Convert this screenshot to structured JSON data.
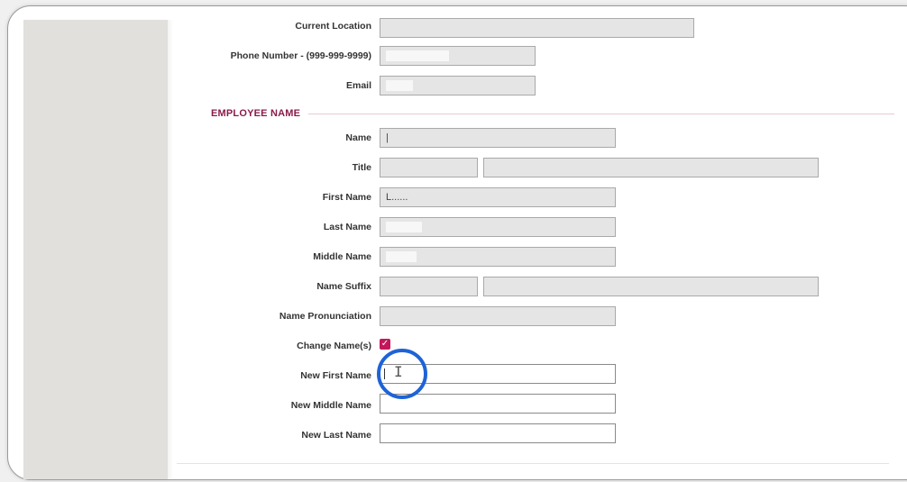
{
  "form": {
    "contact": {
      "current_location_label": "Current Location",
      "phone_label": "Phone Number - (999-999-9999)",
      "email_label": "Email"
    },
    "section_title": "EMPLOYEE NAME",
    "employee_name": {
      "name_label": "Name",
      "name_value": "|",
      "title_label": "Title",
      "first_name_label": "First Name",
      "first_name_value": "L......",
      "last_name_label": "Last Name",
      "middle_name_label": "Middle Name",
      "name_suffix_label": "Name Suffix",
      "name_pronunciation_label": "Name Pronunciation",
      "change_names_label": "Change Name(s)",
      "change_names_checked": true,
      "new_first_name_label": "New First Name",
      "new_first_name_value": "",
      "new_middle_name_label": "New Middle Name",
      "new_last_name_label": "New Last Name"
    }
  },
  "colors": {
    "section_accent": "#8c1b4a",
    "checkbox": "#c2185b",
    "highlight_circle": "#1e63d6"
  },
  "icons": {
    "cursor": "text-cursor-icon",
    "checkbox": "checkmark-icon"
  }
}
